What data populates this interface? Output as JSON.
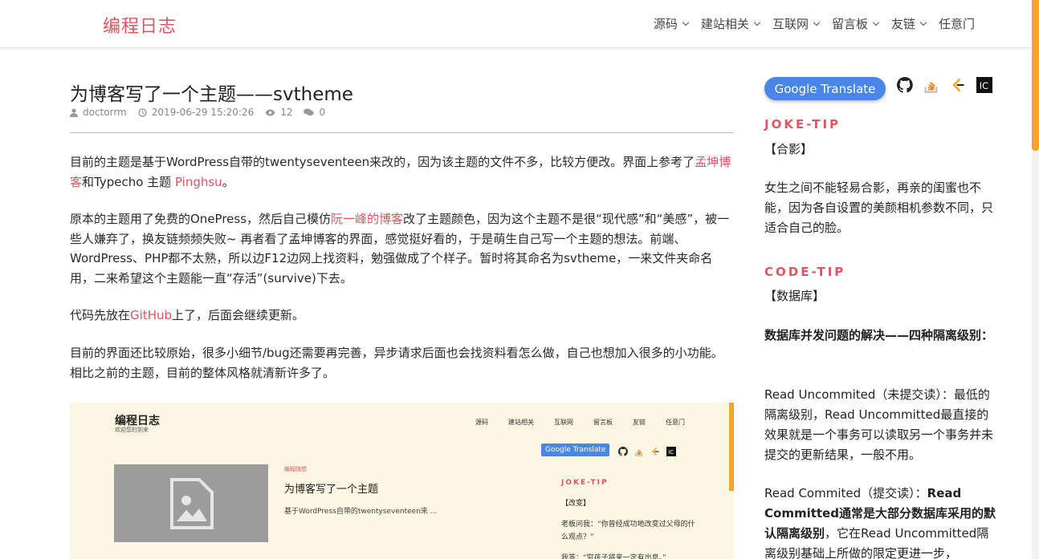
{
  "header": {
    "brand": "编程日志",
    "nav": [
      {
        "label": "源码",
        "dropdown": true
      },
      {
        "label": "建站相关",
        "dropdown": true
      },
      {
        "label": "互联网",
        "dropdown": true
      },
      {
        "label": "留言板",
        "dropdown": true
      },
      {
        "label": "友链",
        "dropdown": true
      },
      {
        "label": "任意门",
        "dropdown": false
      }
    ]
  },
  "post": {
    "title": "为博客写了一个主题——svtheme",
    "meta": {
      "author": "doctorrm",
      "date": "2019-06-29 15:20:26",
      "views": "12",
      "comments": "0"
    },
    "p1": {
      "a": "目前的主题是基于WordPress自带的twentyseventeen来改的，因为该主题的文件不多，比较方便改。界面上参考了",
      "link1": "孟坤博客",
      "b": "和Typecho 主题 ",
      "link2": "Pinghsu",
      "c": "。"
    },
    "p2": {
      "a": "原本的主题用了免费的OnePress，然后自己模仿",
      "link": "阮一峰的博客",
      "b": "改了主题颜色，因为这个主题不是很“现代感”和“美感”，被一些人嫌弃了，换友链频频失败~ 再者看了孟坤博客的界面，感觉挺好看的，于是萌生自己写一个主题的想法。前端、WordPress、PHP都不太熟，所以边F12边网上找资料，勉强做成了个样子。暂时将其命名为svtheme，一来文件夹命名用，二来希望这个主题能一直“存活”(survive)下去。"
    },
    "p3": {
      "a": "代码先放在",
      "link": "GitHub",
      "b": "上了，后面会继续更新。"
    },
    "p4": "目前的界面还比较原始，很多小细节/bug还需要再完善，异步请求后面也会找资料看怎么做，自己也想加入很多的小功能。相比之前的主题，目前的整体风格就清新许多了。"
  },
  "screenshot": {
    "brand": "编程日志",
    "subtitle": "欢迎您的到来",
    "nav": [
      "源码",
      "建站相关",
      "互联网",
      "留言板",
      "友链",
      "任意门"
    ],
    "gt_label": "Google Translate",
    "category": "编程随想",
    "title": "为博客写了一个主题",
    "excerpt": "基于WordPress自带的twentyseventeen来 ...",
    "tip_head": "JOKE-TIP",
    "tip_sub": "【改变】",
    "tip_text": "老板问我：“你曾经成功地改变过父母的什么观点？”",
    "tip_text2": "我答：“穷孩子将来一定有出息。”"
  },
  "sidebar": {
    "gt_label": "Google Translate",
    "icons": [
      "github-icon",
      "stackoverflow-icon",
      "leetcode-icon",
      "codingame-icon"
    ],
    "joke": {
      "head": "JOKE-TIP",
      "sub": "【合影】",
      "text": "女生之间不能轻易合影，再亲的闺蜜也不能，因为各自设置的美颜相机参数不同，只适合自己的脸。"
    },
    "code": {
      "head": "CODE-TIP",
      "sub": "【数据库】",
      "title": "数据库并发问题的解决——四种隔离级别：",
      "t1": "Read Uncommited（未提交读）：最低的隔离级别，Read Uncommitted最直接的效果就是一个事务可以读取另一个事务并未提交的更新结果，一般不用。",
      "t2a": "Read Commited（提交读）：",
      "t2b": "Read Committed通常是大部分数据库采用的默认隔离级别",
      "t2c": "，它在Read Uncommitted隔离级别基础上所做的限定更进一步，"
    }
  },
  "colors": {
    "accent": "#e0555f",
    "google_blue": "#4a86e8",
    "scroll_orange": "#f7a52a",
    "embed_bg": "#fbf7e3"
  }
}
